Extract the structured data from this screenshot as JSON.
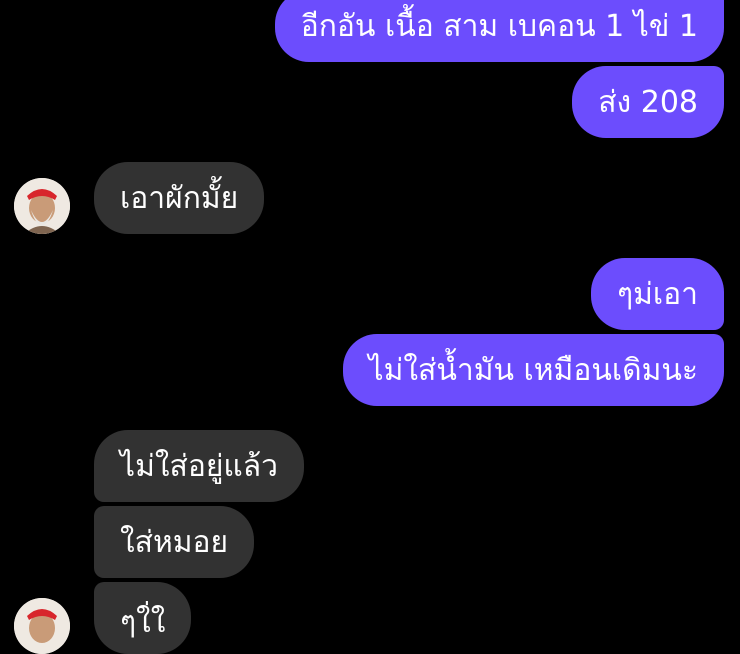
{
  "conversation": {
    "messages": [
      {
        "direction": "outgoing",
        "text": "อีกอัน เนื้อ สาม เบคอน 1 ไข่ 1"
      },
      {
        "direction": "outgoing",
        "text": "ส่ง 208"
      },
      {
        "direction": "incoming",
        "text": "เอาผักมั้ย"
      },
      {
        "direction": "outgoing",
        "text": "ๆม่เอา"
      },
      {
        "direction": "outgoing",
        "text": "ไม่ใส่น้ำมัน เหมือนเดิมนะ"
      },
      {
        "direction": "incoming",
        "text": "ไม่ใส่อยู่แล้ว"
      },
      {
        "direction": "incoming",
        "text": "ใส่หมอย"
      },
      {
        "direction": "incoming",
        "text": "ๆใ่ใ"
      }
    ]
  },
  "colors": {
    "background": "#000000",
    "outgoing_bubble": "#6c4dfd",
    "incoming_bubble": "#323232",
    "text": "#ffffff"
  },
  "icons": {
    "contact_avatar": "avatar-icon"
  }
}
